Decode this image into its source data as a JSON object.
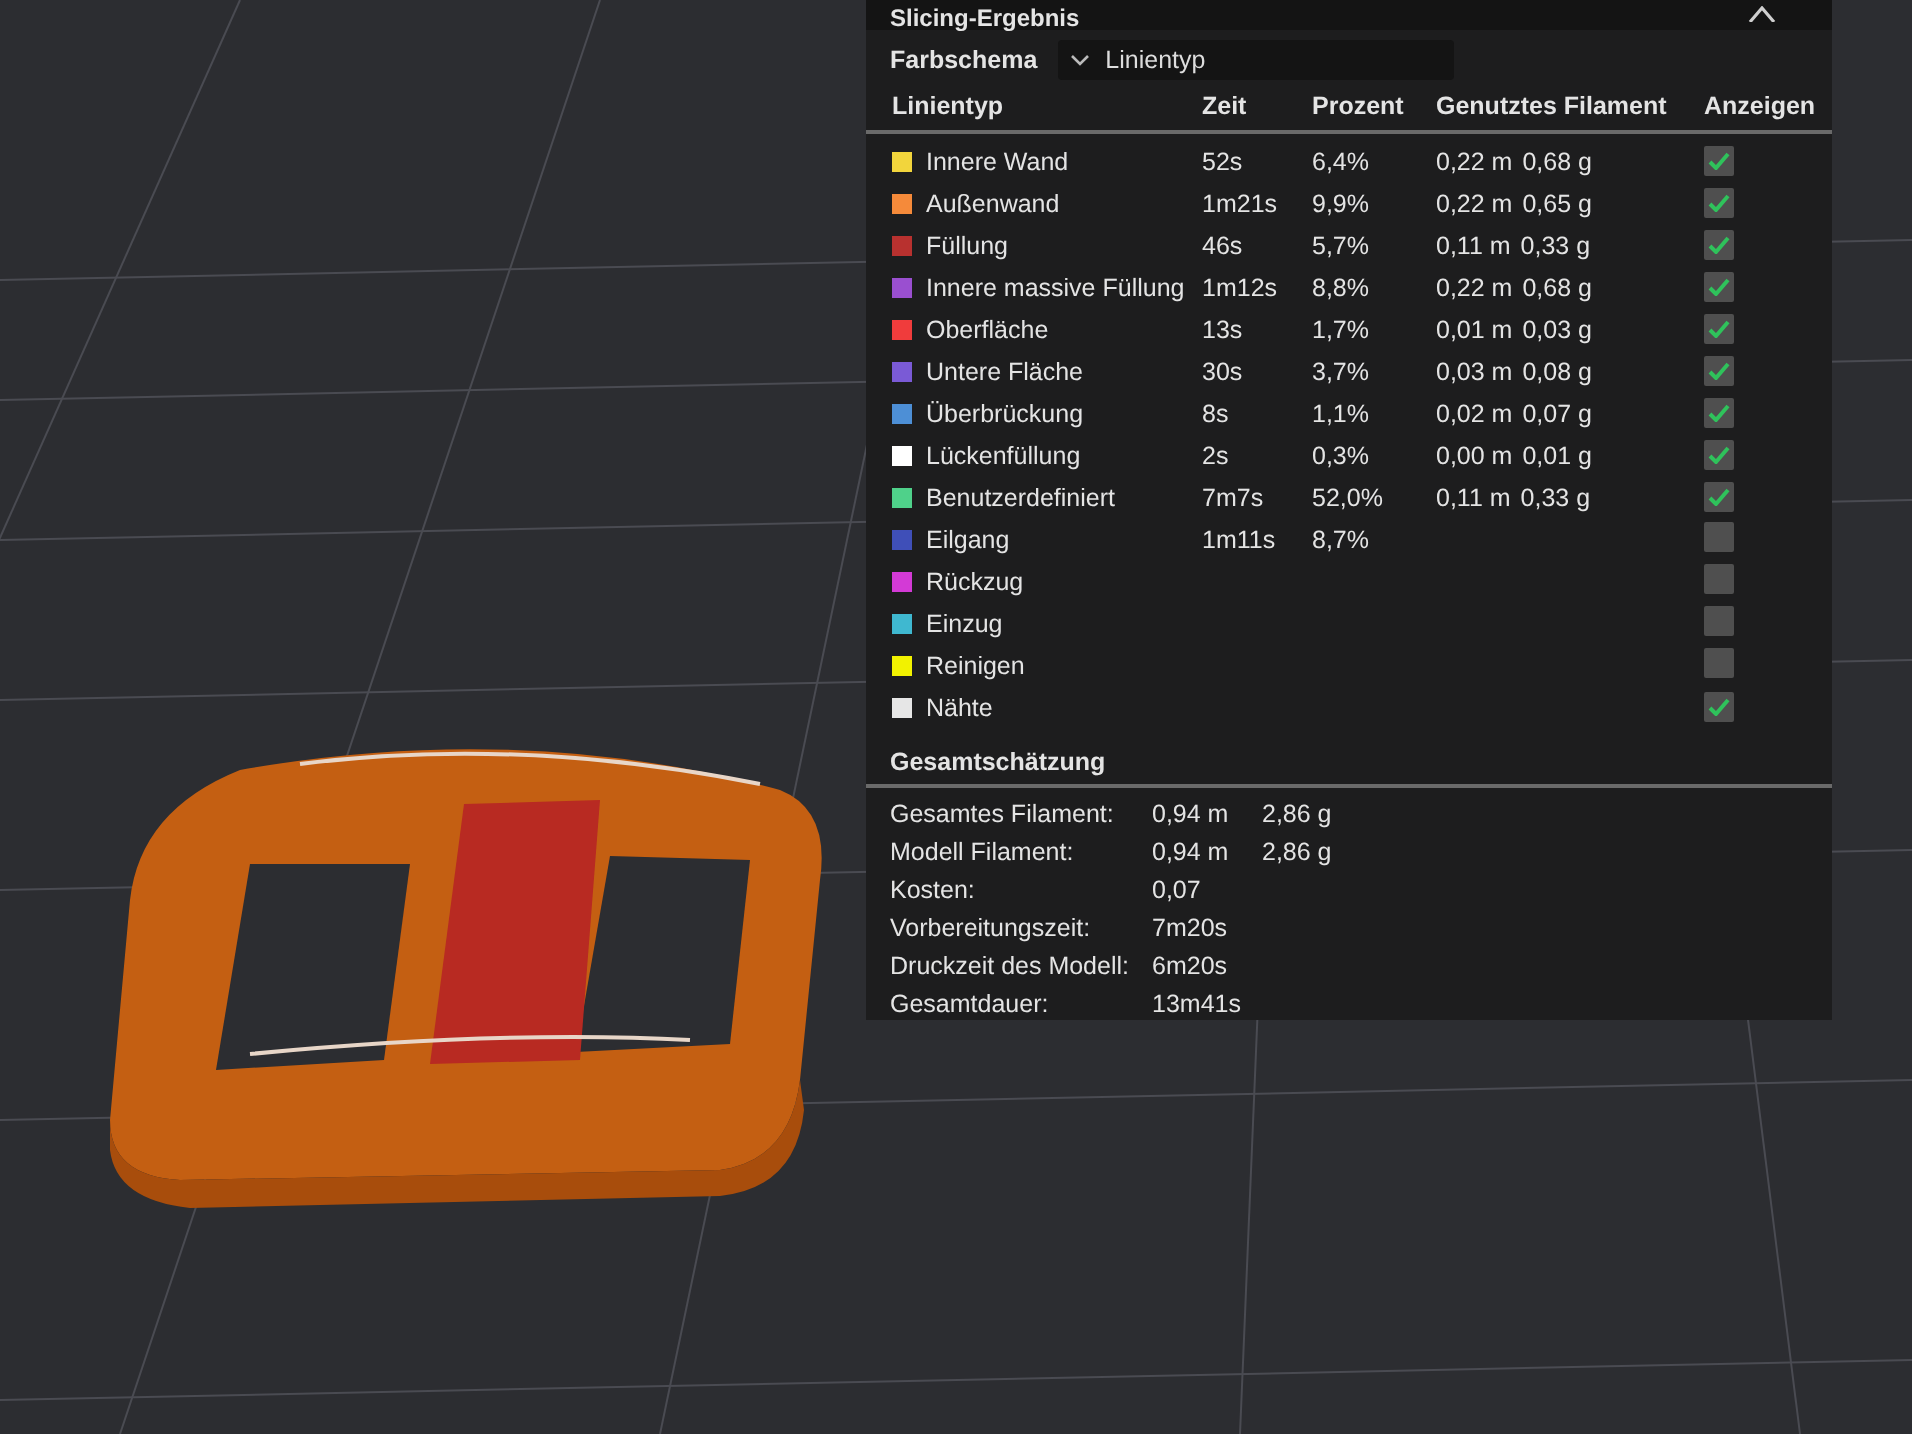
{
  "panel": {
    "title": "Slicing-Ergebnis",
    "color_scheme": {
      "label": "Farbschema",
      "value": "Linientyp"
    },
    "columns": [
      "Linientyp",
      "Zeit",
      "Prozent",
      "Genutztes Filament",
      "Anzeigen"
    ],
    "rows": [
      {
        "name": "Innere Wand",
        "color": "#f2d53c",
        "time": "52s",
        "percent": "6,4%",
        "length": "0,22 m",
        "weight": "0,68 g",
        "checked": true
      },
      {
        "name": "Außenwand",
        "color": "#f58a3a",
        "time": "1m21s",
        "percent": "9,9%",
        "length": "0,22 m",
        "weight": "0,65 g",
        "checked": true
      },
      {
        "name": "Füllung",
        "color": "#b8312f",
        "time": "46s",
        "percent": "5,7%",
        "length": "0,11 m",
        "weight": "0,33 g",
        "checked": true
      },
      {
        "name": "Innere massive Füllung",
        "color": "#9a4fd0",
        "time": "1m12s",
        "percent": "8,8%",
        "length": "0,22 m",
        "weight": "0,68 g",
        "checked": true
      },
      {
        "name": "Oberfläche",
        "color": "#f03c3c",
        "time": "13s",
        "percent": "1,7%",
        "length": "0,01 m",
        "weight": "0,03 g",
        "checked": true
      },
      {
        "name": "Untere Fläche",
        "color": "#7a5ad6",
        "time": "30s",
        "percent": "3,7%",
        "length": "0,03 m",
        "weight": "0,08 g",
        "checked": true
      },
      {
        "name": "Überbrückung",
        "color": "#4d8fd6",
        "time": "8s",
        "percent": "1,1%",
        "length": "0,02 m",
        "weight": "0,07 g",
        "checked": true
      },
      {
        "name": "Lückenfüllung",
        "color": "#ffffff",
        "time": "2s",
        "percent": "0,3%",
        "length": "0,00 m",
        "weight": "0,01 g",
        "checked": true
      },
      {
        "name": "Benutzerdefiniert",
        "color": "#4fd18a",
        "time": "7m7s",
        "percent": "52,0%",
        "length": "0,11 m",
        "weight": "0,33 g",
        "checked": true
      },
      {
        "name": "Eilgang",
        "color": "#3f4fb8",
        "time": "1m11s",
        "percent": "8,7%",
        "checked": false
      },
      {
        "name": "Rückzug",
        "color": "#d33ad6",
        "checked": false
      },
      {
        "name": "Einzug",
        "color": "#3fb8d0",
        "checked": false
      },
      {
        "name": "Reinigen",
        "color": "#f2f200",
        "checked": false
      },
      {
        "name": "Nähte",
        "color": "#e6e6e6",
        "checked": true
      }
    ],
    "summary_title": "Gesamtschätzung",
    "summary": [
      {
        "label": "Gesamtes Filament:",
        "value": "0,94 m",
        "value_2": "2,86 g"
      },
      {
        "label": "Modell Filament:",
        "value": "0,94 m",
        "value_2": "2,86 g"
      },
      {
        "label": "Kosten:",
        "value": "0,07"
      },
      {
        "label": "Vorbereitungszeit:",
        "value": "7m20s"
      },
      {
        "label": "Druckzeit des Modell:",
        "value": "6m20s"
      },
      {
        "label": "Gesamtdauer:",
        "value": "13m41s"
      }
    ]
  }
}
